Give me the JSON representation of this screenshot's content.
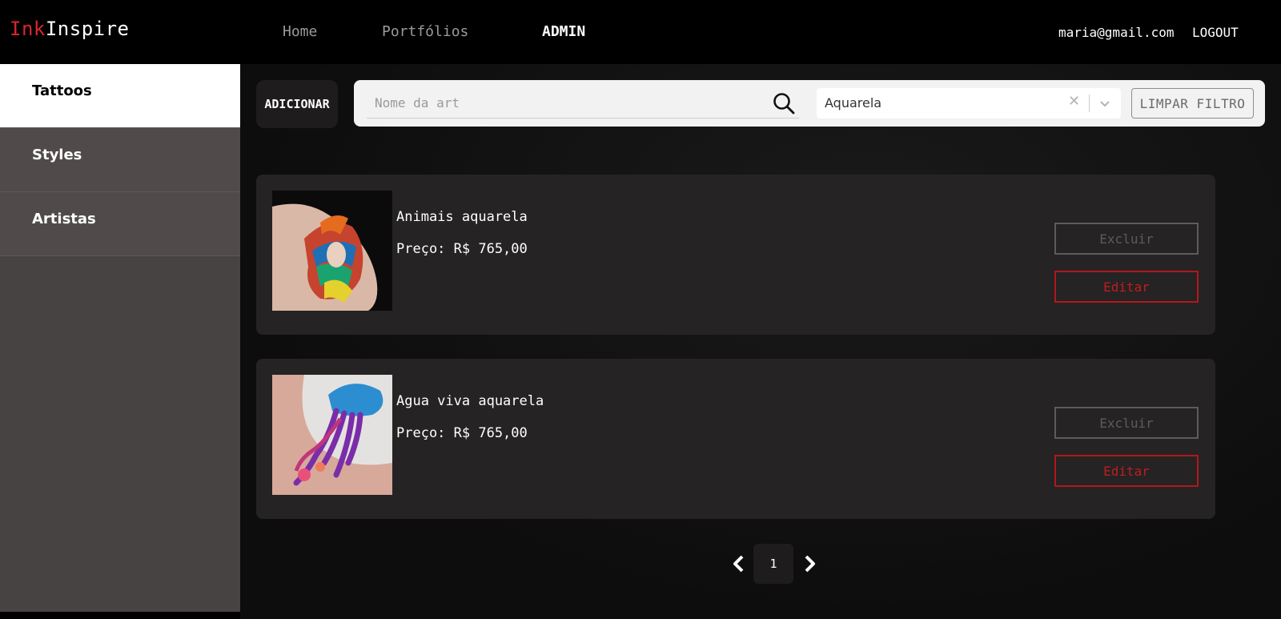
{
  "navbar": {
    "logo_part1": "Ink",
    "logo_part2": "Inspire",
    "links": [
      "Home",
      "Portfólios",
      "ADMIN"
    ],
    "user_email": "maria@gmail.com",
    "logout": "LOGOUT"
  },
  "sidebar": {
    "items": [
      {
        "label": "Tattoos",
        "active": true
      },
      {
        "label": "Styles",
        "active": false
      },
      {
        "label": "Artistas",
        "active": false
      }
    ]
  },
  "toolbar": {
    "add_label": "ADICIONAR",
    "search_placeholder": "Nome da art",
    "search_value": "",
    "style_filter_value": "Aquarela",
    "clear_filter_label": "LIMPAR FILTRO"
  },
  "tattoos": [
    {
      "name": "Animais aquarela",
      "price": "Preço: R$ 765,00",
      "delete_label": "Excluir",
      "edit_label": "Editar"
    },
    {
      "name": "Agua viva aquarela",
      "price": "Preço: R$ 765,00",
      "delete_label": "Excluir",
      "edit_label": "Editar"
    }
  ],
  "pagination": {
    "current_page": "1"
  },
  "colors": {
    "brand_red": "#d9262c",
    "sidebar": "#504b4a",
    "card": "#252324"
  }
}
